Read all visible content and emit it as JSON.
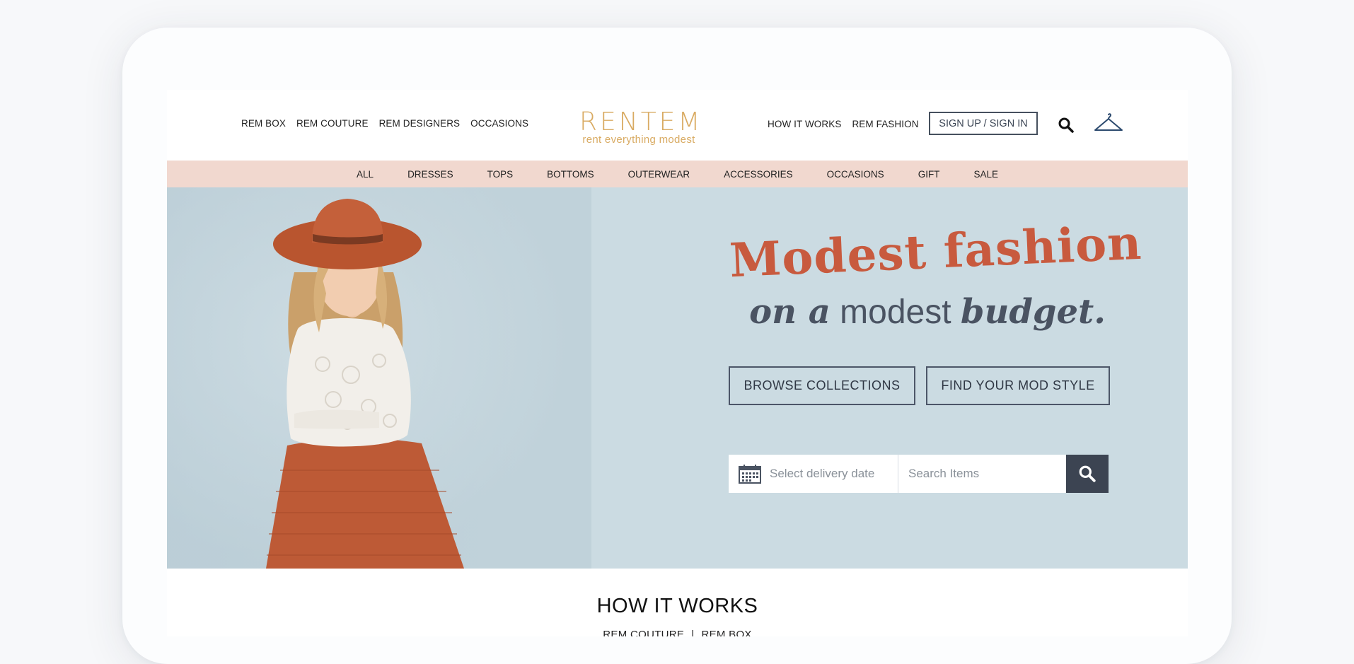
{
  "header": {
    "left_nav": [
      "REM BOX",
      "REM COUTURE",
      "REM DESIGNERS",
      "OCCASIONS"
    ],
    "logo": {
      "word": "RENTEM",
      "tagline": "rent everything modest",
      "color": "#d9ab63"
    },
    "right_nav": [
      "HOW IT WORKS",
      "REM FASHION"
    ],
    "signin_label": "SIGN UP / SIGN IN",
    "icons": {
      "search": "search-icon",
      "wardrobe": "hanger-icon"
    }
  },
  "categories": [
    "ALL",
    "DRESSES",
    "TOPS",
    "BOTTOMS",
    "OUTERWEAR",
    "ACCESSORIES",
    "OCCASIONS",
    "GIFT",
    "SALE"
  ],
  "hero": {
    "headline": "Modest fashion",
    "subline": {
      "part1": "on a",
      "part2": "modest",
      "part3": "budget."
    },
    "buttons": {
      "browse": "BROWSE COLLECTIONS",
      "style": "FIND YOUR MOD STYLE"
    },
    "date_placeholder": "Select delivery date",
    "search_placeholder": "Search Items",
    "icons": {
      "calendar": "calendar-icon",
      "search": "search-icon"
    }
  },
  "how_it_works": {
    "title": "HOW IT WORKS",
    "tabs": [
      "REM COUTURE",
      "REM BOX"
    ],
    "separator": "|"
  },
  "colors": {
    "accent_red": "#c85a3e",
    "category_bar": "#f1d8cf",
    "hero_bg": "#cbdbe2",
    "dark_button": "#3c4452"
  }
}
